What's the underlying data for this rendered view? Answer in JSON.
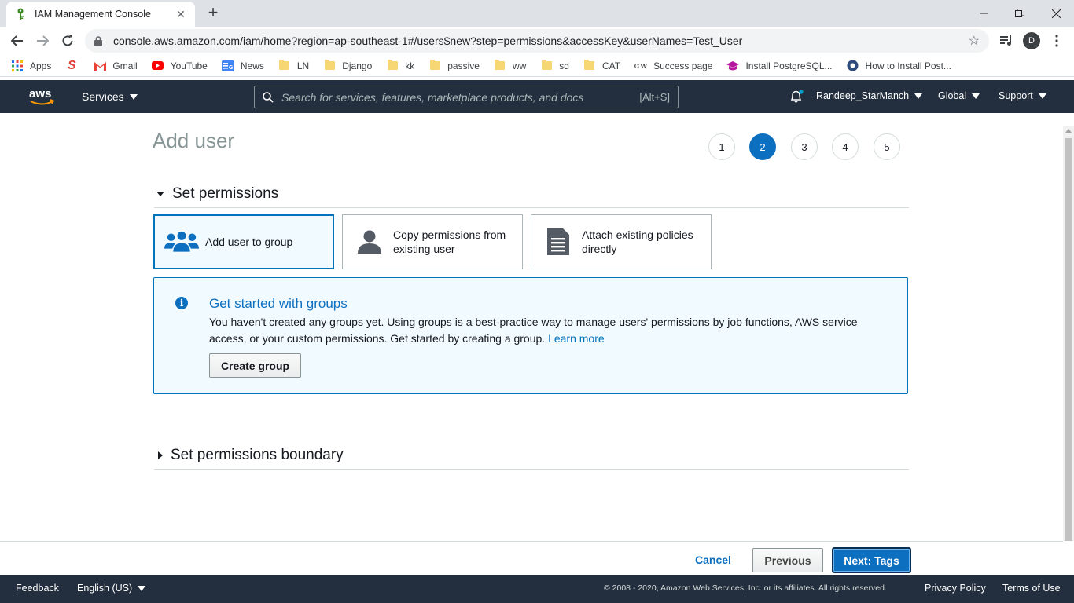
{
  "browser": {
    "tab_title": "IAM Management Console",
    "url": "console.aws.amazon.com/iam/home?region=ap-southeast-1#/users$new?step=permissions&accessKey&userNames=Test_User",
    "profile_initial": "D",
    "bookmarks": [
      {
        "label": "Apps",
        "icon": "apps-grid-icon"
      },
      {
        "label": "",
        "icon": "s-logo-icon"
      },
      {
        "label": "Gmail",
        "icon": "gmail-icon"
      },
      {
        "label": "YouTube",
        "icon": "youtube-icon"
      },
      {
        "label": "News",
        "icon": "google-news-icon"
      },
      {
        "label": "LN",
        "icon": "folder-icon"
      },
      {
        "label": "Django",
        "icon": "folder-icon"
      },
      {
        "label": "kk",
        "icon": "folder-icon"
      },
      {
        "label": "passive",
        "icon": "folder-icon"
      },
      {
        "label": "ww",
        "icon": "folder-icon"
      },
      {
        "label": "sd",
        "icon": "folder-icon"
      },
      {
        "label": "CAT",
        "icon": "folder-icon"
      },
      {
        "label": "Success page",
        "icon": "aw-icon"
      },
      {
        "label": "Install PostgreSQL...",
        "icon": "graduation-cap-icon"
      },
      {
        "label": "How to Install Post...",
        "icon": "circle-site-icon"
      }
    ]
  },
  "aws_header": {
    "services_label": "Services",
    "search_placeholder": "Search for services, features, marketplace products, and docs",
    "search_shortcut": "[Alt+S]",
    "account": "Randeep_StarManch",
    "region": "Global",
    "support": "Support"
  },
  "page": {
    "title": "Add user",
    "steps": [
      "1",
      "2",
      "3",
      "4",
      "5"
    ],
    "active_step": 2,
    "set_permissions_heading": "Set permissions",
    "options": [
      {
        "label": "Add user to group",
        "icon": "users-group-icon",
        "selected": true
      },
      {
        "label": "Copy permissions from existing user",
        "icon": "single-user-icon",
        "selected": false
      },
      {
        "label": "Attach existing policies directly",
        "icon": "document-icon",
        "selected": false
      }
    ],
    "info": {
      "title": "Get started with groups",
      "body": "You haven't created any groups yet. Using groups is a best-practice way to manage users' permissions by job functions, AWS service access, or your custom permissions. Get started by creating a group.",
      "link": "Learn more",
      "button": "Create group"
    },
    "boundary_heading": "Set permissions boundary"
  },
  "actions": {
    "cancel": "Cancel",
    "previous": "Previous",
    "next": "Next: Tags"
  },
  "footer": {
    "feedback": "Feedback",
    "language": "English (US)",
    "copyright": "© 2008 - 2020, Amazon Web Services, Inc. or its affiliates. All rights reserved.",
    "privacy": "Privacy Policy",
    "terms": "Terms of Use"
  },
  "colors": {
    "aws_nav": "#232f3e",
    "primary_blue": "#0d6fbf",
    "info_bg": "#f1faff"
  }
}
